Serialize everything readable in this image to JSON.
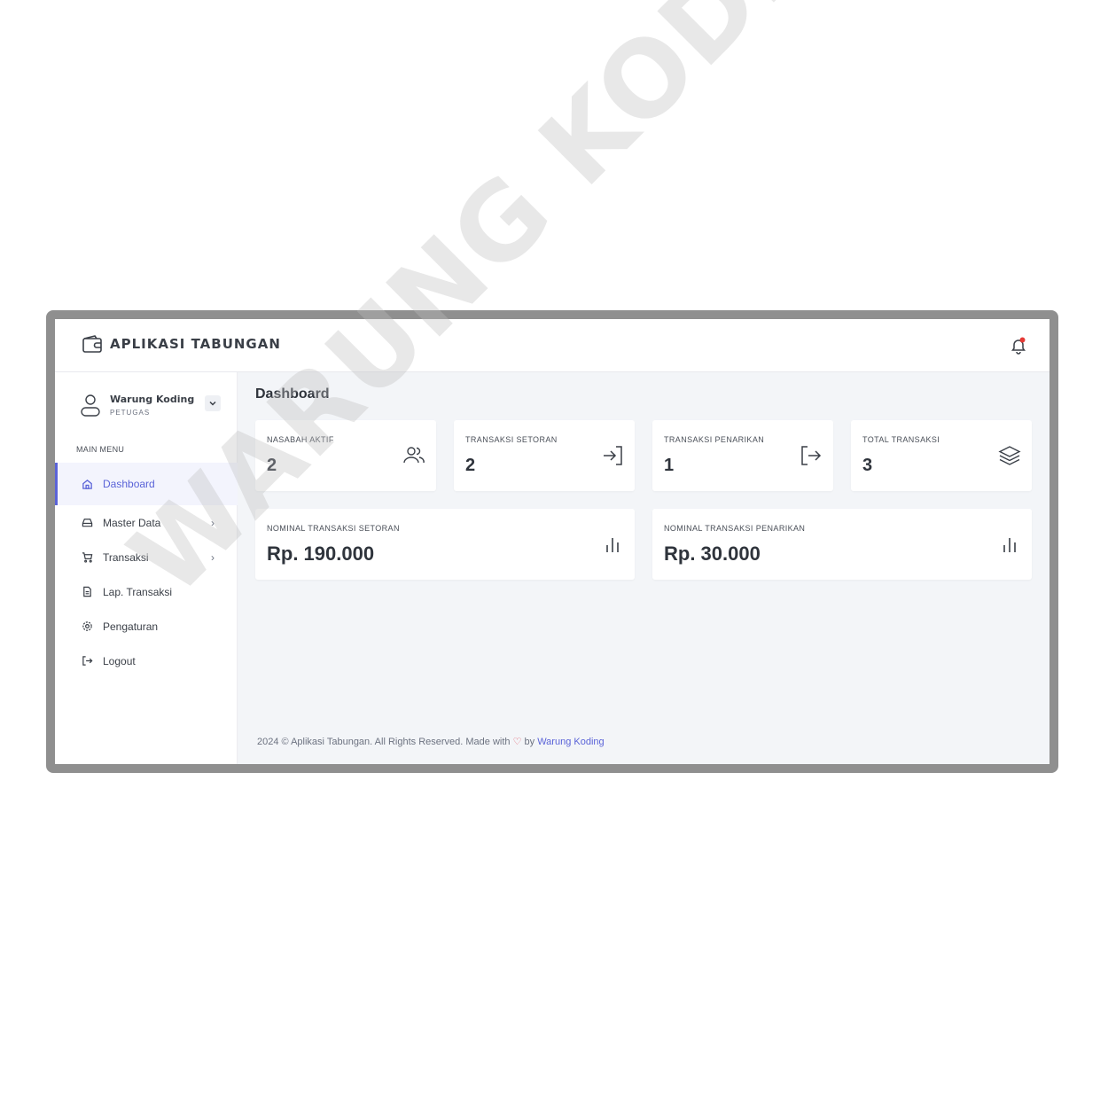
{
  "app": {
    "title": "APLIKASI TABUNGAN"
  },
  "user": {
    "name": "Warung Koding",
    "role": "PETUGAS"
  },
  "sidebar": {
    "menu_title": "MAIN MENU",
    "items": [
      {
        "label": "Dashboard",
        "icon": "home-icon",
        "active": true
      },
      {
        "label": "Master Data",
        "icon": "drive-icon",
        "has_submenu": true
      },
      {
        "label": "Transaksi",
        "icon": "cart-icon",
        "has_submenu": true
      },
      {
        "label": "Lap. Transaksi",
        "icon": "document-icon"
      },
      {
        "label": "Pengaturan",
        "icon": "gear-icon"
      },
      {
        "label": "Logout",
        "icon": "logout-icon"
      }
    ]
  },
  "main": {
    "title": "Dashboard",
    "stats": [
      {
        "label": "NASABAH AKTIF",
        "value": "2",
        "icon": "users-icon"
      },
      {
        "label": "TRANSAKSI SETORAN",
        "value": "2",
        "icon": "login-icon"
      },
      {
        "label": "TRANSAKSI PENARIKAN",
        "value": "1",
        "icon": "logout-icon"
      },
      {
        "label": "TOTAL TRANSAKSI",
        "value": "3",
        "icon": "layers-icon"
      }
    ],
    "totals": [
      {
        "label": "NOMINAL TRANSAKSI SETORAN",
        "value": "Rp. 190.000",
        "icon": "bar-chart-icon"
      },
      {
        "label": "NOMINAL TRANSAKSI PENARIKAN",
        "value": "Rp. 30.000",
        "icon": "bar-chart-icon"
      }
    ]
  },
  "footer": {
    "text": "2024 © Aplikasi Tabungan. All Rights Reserved. Made with",
    "by": "by",
    "link": "Warung Koding"
  },
  "watermark": "WARUNG KODING",
  "colors": {
    "accent": "#5a63d8",
    "notification": "#e53935",
    "background": "#f3f5f8"
  }
}
